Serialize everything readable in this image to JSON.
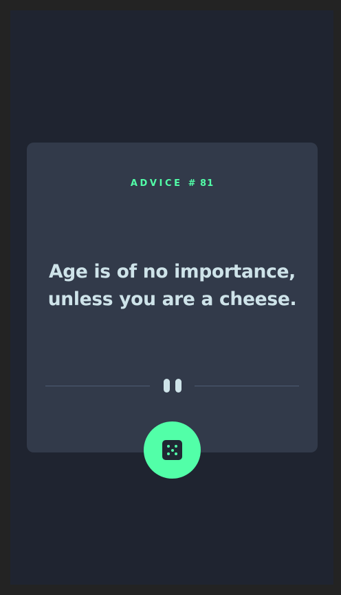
{
  "advice": {
    "label": "ADVICE",
    "number": "# 81",
    "quote": "Age is of no importance, unless you are a cheese."
  },
  "divider": {
    "icon": "pause-icon"
  },
  "actions": {
    "new_advice_icon": "dice-icon"
  },
  "colors": {
    "page_bg": "#1f2430",
    "card_bg": "#323a4a",
    "accent": "#52ffa8",
    "text": "#cee3e9",
    "divider": "#4f5d74"
  }
}
